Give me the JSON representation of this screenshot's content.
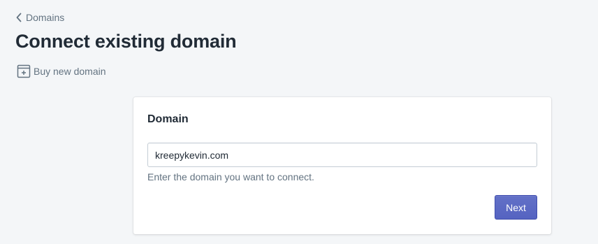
{
  "breadcrumb": {
    "label": "Domains",
    "icon": "chevron-left-icon"
  },
  "page": {
    "title": "Connect existing domain"
  },
  "secondary_action": {
    "label": "Buy new domain",
    "icon": "buy-domain-icon"
  },
  "card": {
    "title": "Domain",
    "domain_input": {
      "value": "kreepykevin.com"
    },
    "help_text": "Enter the domain you want to connect.",
    "next_label": "Next"
  },
  "colors": {
    "background": "#f4f6f8",
    "primary_button": "#5c6ac4",
    "muted_text": "#637381"
  }
}
